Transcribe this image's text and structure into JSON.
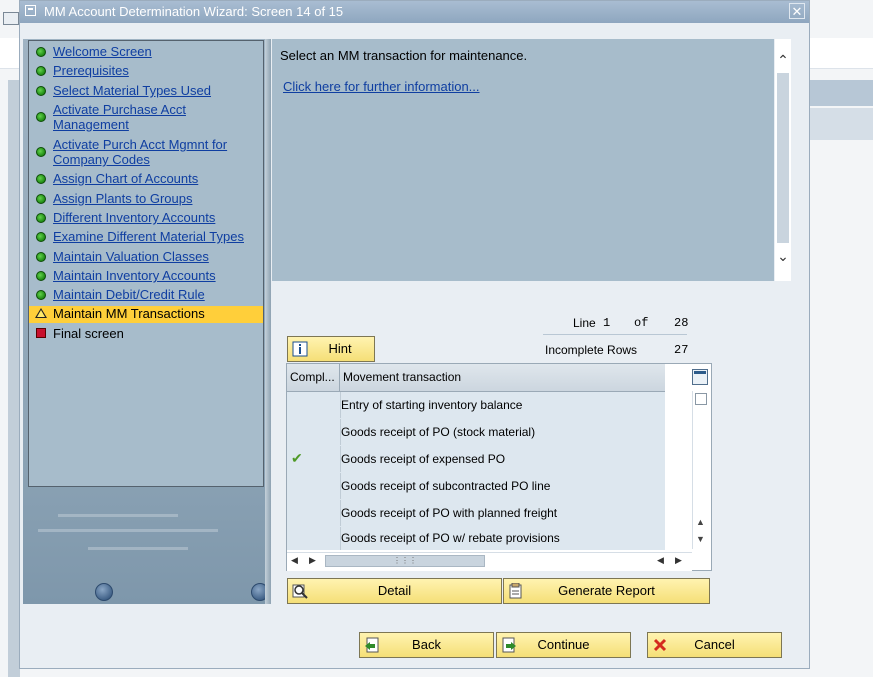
{
  "window": {
    "title": "MM Account Determination Wizard: Screen 14 of 15",
    "close_glyph": "✕"
  },
  "nav": {
    "items": [
      {
        "label": "Welcome Screen"
      },
      {
        "label": "Prerequisites"
      },
      {
        "label": "Select Material Types Used"
      },
      {
        "label": "Activate Purchase Acct Management"
      },
      {
        "label": "Activate Purch Acct Mgmnt for Company Codes"
      },
      {
        "label": "Assign Chart of Accounts"
      },
      {
        "label": "Assign Plants to Groups"
      },
      {
        "label": "Different Inventory Accounts"
      },
      {
        "label": "Examine Different Material Types"
      },
      {
        "label": "Maintain Valuation Classes"
      },
      {
        "label": "Maintain Inventory Accounts"
      },
      {
        "label": "Maintain Debit/Credit Rule"
      },
      {
        "label": "Maintain MM Transactions"
      },
      {
        "label": "Final screen"
      }
    ]
  },
  "info": {
    "text": "Select an MM transaction for maintenance.",
    "link": "Click here for further information..."
  },
  "counter": {
    "line_label": "Line",
    "line_value": "1",
    "of_label": "of",
    "total_value": "28",
    "incomplete_label": "Incomplete Rows",
    "incomplete_value": "27"
  },
  "buttons": {
    "hint": "Hint",
    "detail": "Detail",
    "generate_report": "Generate Report",
    "back": "Back",
    "continue": "Continue",
    "cancel": "Cancel"
  },
  "table": {
    "columns": [
      "Compl...",
      "Movement transaction"
    ],
    "rows": [
      {
        "complete": false,
        "transaction": "Entry of starting inventory balance"
      },
      {
        "complete": false,
        "transaction": "Goods receipt of PO (stock material)"
      },
      {
        "complete": true,
        "transaction": "Goods receipt of expensed PO"
      },
      {
        "complete": false,
        "transaction": "Goods receipt of subcontracted PO line"
      },
      {
        "complete": false,
        "transaction": "Goods receipt of PO with planned freight"
      },
      {
        "complete": false,
        "transaction": "Goods receipt of PO w/ rebate provisions"
      }
    ],
    "check_glyph": "✔"
  },
  "icons": {
    "nav_done": "green-dot-icon",
    "nav_current": "warning-triangle-icon",
    "nav_final": "red-square-icon",
    "hint": "info-icon",
    "detail": "detail-magnifier-icon",
    "report": "report-icon",
    "back": "back-icon",
    "continue": "continue-icon",
    "cancel": "cancel-x-icon"
  },
  "colors": {
    "active_highlight": "#ffcf3a",
    "link": "#0f3ea1",
    "button": "#f5df77"
  }
}
